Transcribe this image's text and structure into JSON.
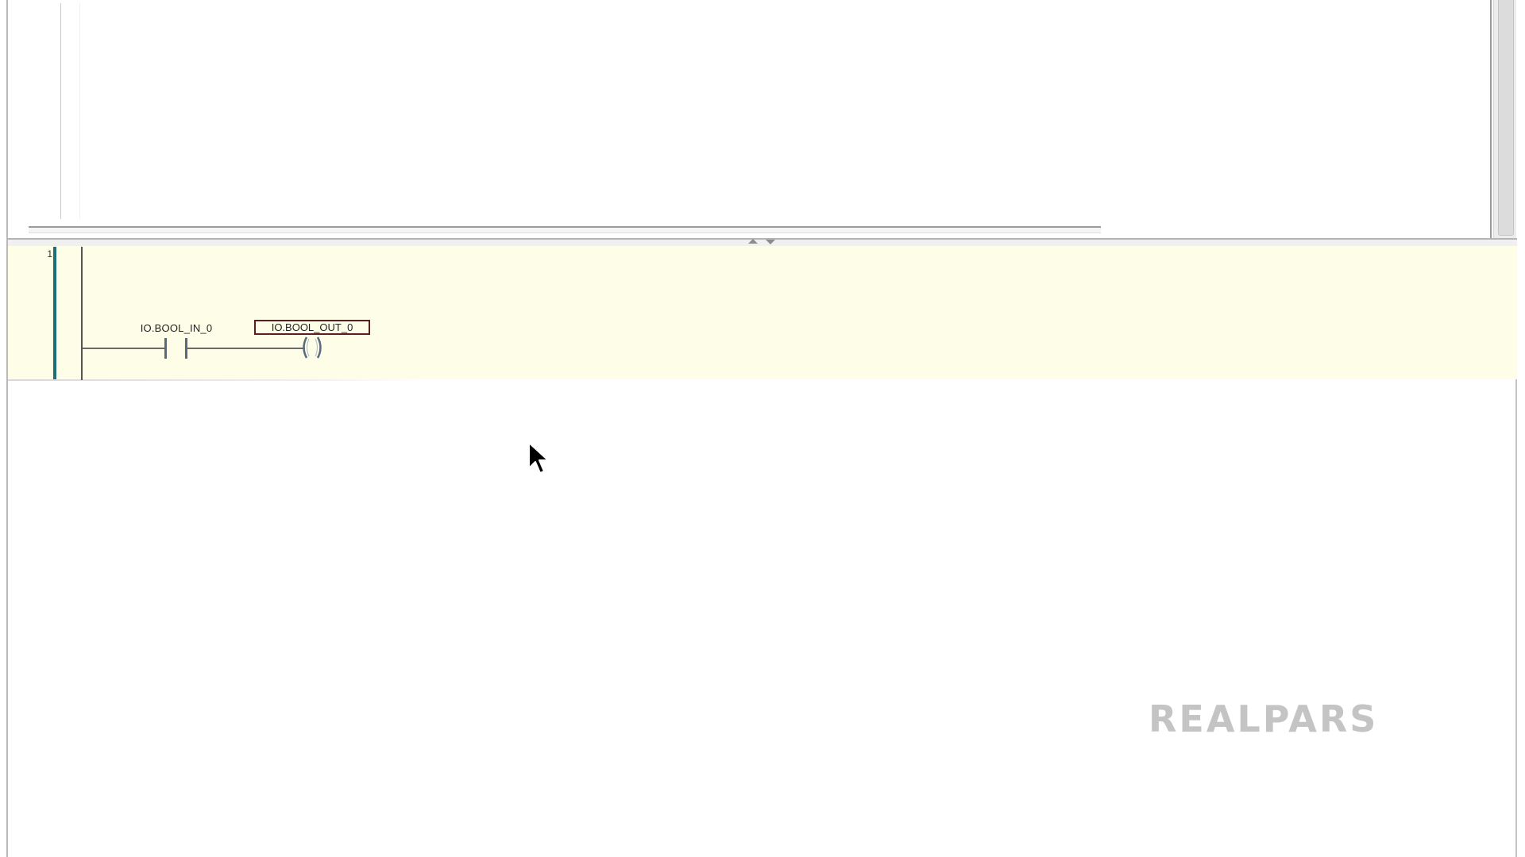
{
  "editor": {
    "network_number": "1"
  },
  "rung": {
    "contact": {
      "tag": "IO.BOOL_IN_0",
      "type": "normally-open-contact"
    },
    "coil": {
      "tag": "IO.BOOL_OUT_0",
      "type": "output-coil"
    }
  },
  "watermark": {
    "logo_text": "REALPARS"
  },
  "colors": {
    "rung_background": "#fefee8",
    "rung_marker": "#1d6f79",
    "selected_tag_border": "#5a1f1f",
    "watermark": "#c4c4c4"
  },
  "icons": {
    "splitter_up": "splitter-up-icon",
    "splitter_down": "splitter-down-icon",
    "cursor": "mouse-pointer-icon"
  }
}
